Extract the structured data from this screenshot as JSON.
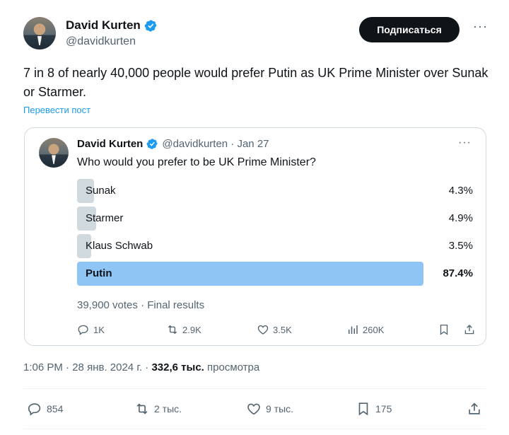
{
  "author": {
    "display_name": "David Kurten",
    "handle": "@davidkurten"
  },
  "header": {
    "subscribe_label": "Подписаться",
    "more_label": "···"
  },
  "tweet": {
    "text": "7 in 8 of nearly 40,000 people would prefer Putin as UK Prime Minister over Sunak or Starmer.",
    "translate_label": "Перевести пост",
    "time": "1:06 PM",
    "date": "28 янв. 2024 г.",
    "views": "332,6 тыс.",
    "views_label": "просмотра",
    "replies": "854",
    "retweets": "2 тыс.",
    "likes": "9 тыс.",
    "bookmarks": "175"
  },
  "quote": {
    "display_name": "David Kurten",
    "handle_date": "@davidkurten · Jan 27",
    "more_label": "···",
    "question": "Who would you prefer to be UK Prime Minister?",
    "poll": [
      {
        "label": "Sunak",
        "pct": "4.3%",
        "value": 0.043
      },
      {
        "label": "Starmer",
        "pct": "4.9%",
        "value": 0.049
      },
      {
        "label": "Klaus Schwab",
        "pct": "3.5%",
        "value": 0.035
      },
      {
        "label": "Putin",
        "pct": "87.4%",
        "value": 0.874
      }
    ],
    "footer": "39,900 votes · Final results",
    "replies": "1K",
    "retweets": "2.9K",
    "likes": "3.5K",
    "views": "260K"
  },
  "colors": {
    "accent": "#1d9bf0",
    "poll_bar": "#cfd9de",
    "poll_bar_winner": "#8ec5f5"
  },
  "icons": {
    "verified": "verified-badge-icon",
    "reply": "reply-icon",
    "retweet": "retweet-icon",
    "like": "heart-icon",
    "views": "views-chart-icon",
    "bookmark": "bookmark-icon",
    "share": "share-icon"
  }
}
